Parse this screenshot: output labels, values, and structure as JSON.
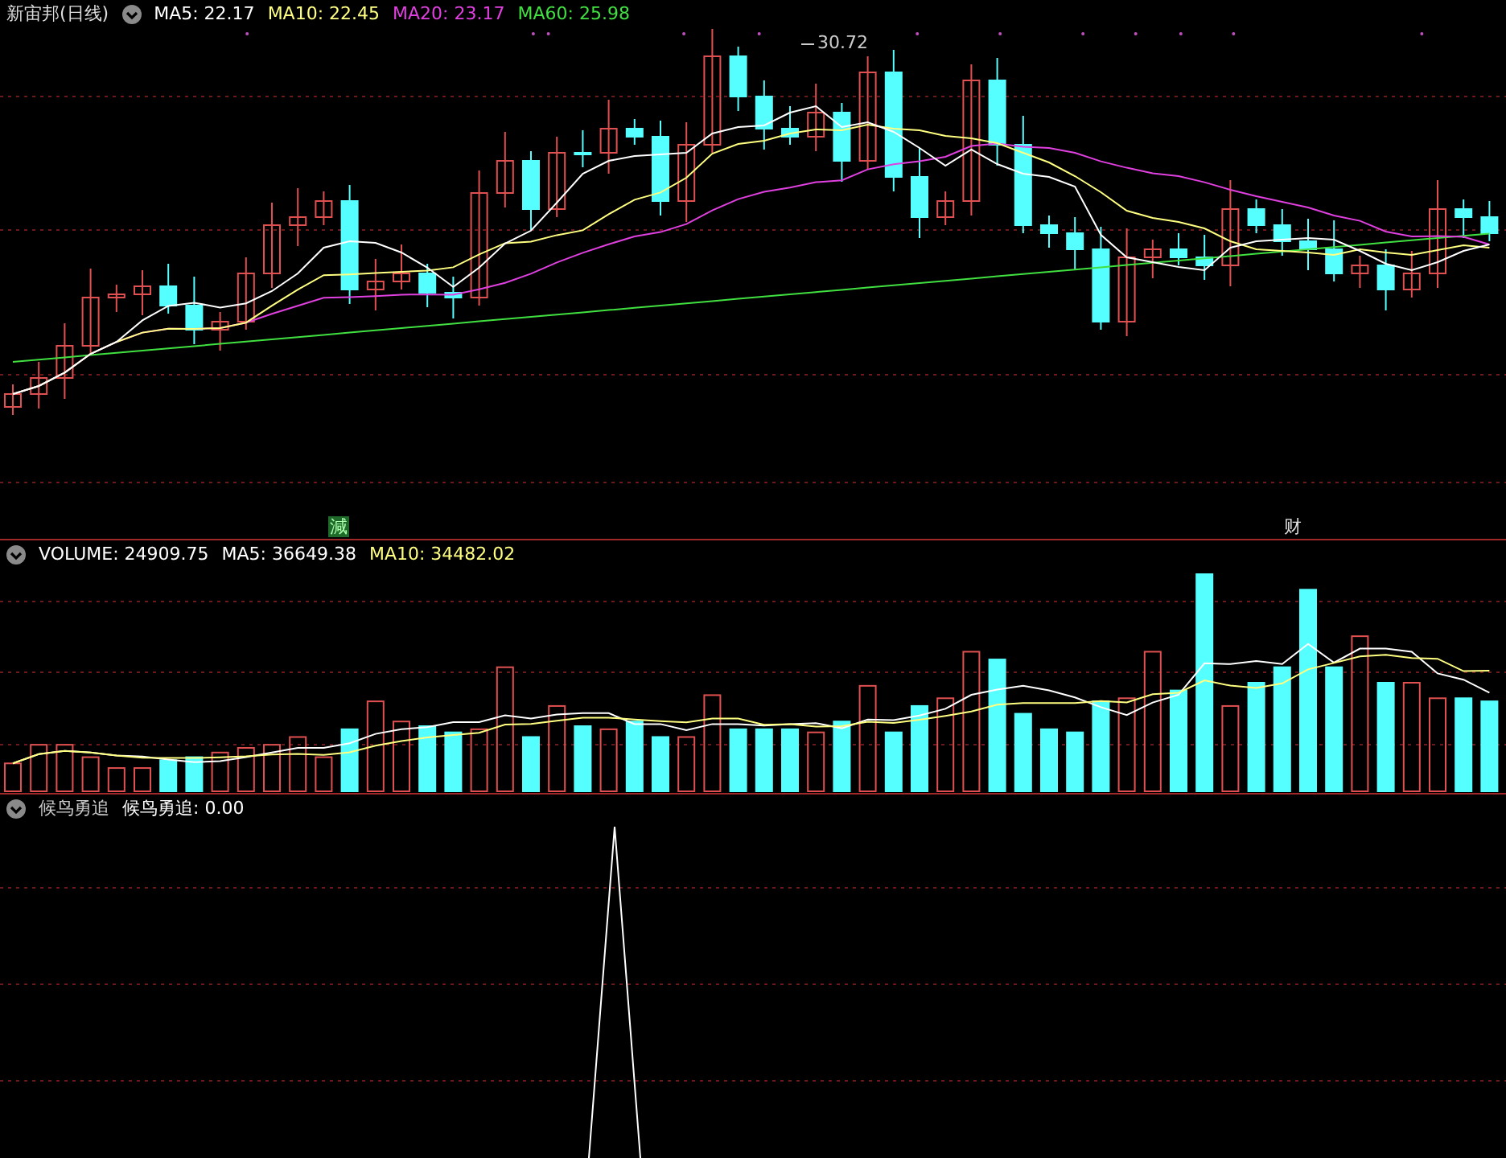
{
  "main_panel": {
    "title": "新宙邦(日线)",
    "legend": [
      {
        "label": "MA5: 22.17",
        "color": "#ffffff"
      },
      {
        "label": "MA10: 22.45",
        "color": "#ffff80"
      },
      {
        "label": "MA20: 23.17",
        "color": "#e040e0"
      },
      {
        "label": "MA60: 25.98",
        "color": "#40e040"
      }
    ],
    "price_label": "30.72",
    "markers": [
      {
        "label": "減",
        "highlighted": true
      },
      {
        "label": "财",
        "highlighted": false
      }
    ]
  },
  "volume_panel": {
    "legend": [
      {
        "label": "VOLUME: 24909.75",
        "color": "#ffffff"
      },
      {
        "label": "MA5: 36649.38",
        "color": "#ffffff"
      },
      {
        "label": "MA10: 34482.02",
        "color": "#ffff80"
      }
    ]
  },
  "indicator_panel": {
    "title": "候鸟勇追",
    "legend": [
      {
        "label": "候鸟勇追: 0.00",
        "color": "#ffffff"
      }
    ]
  }
}
